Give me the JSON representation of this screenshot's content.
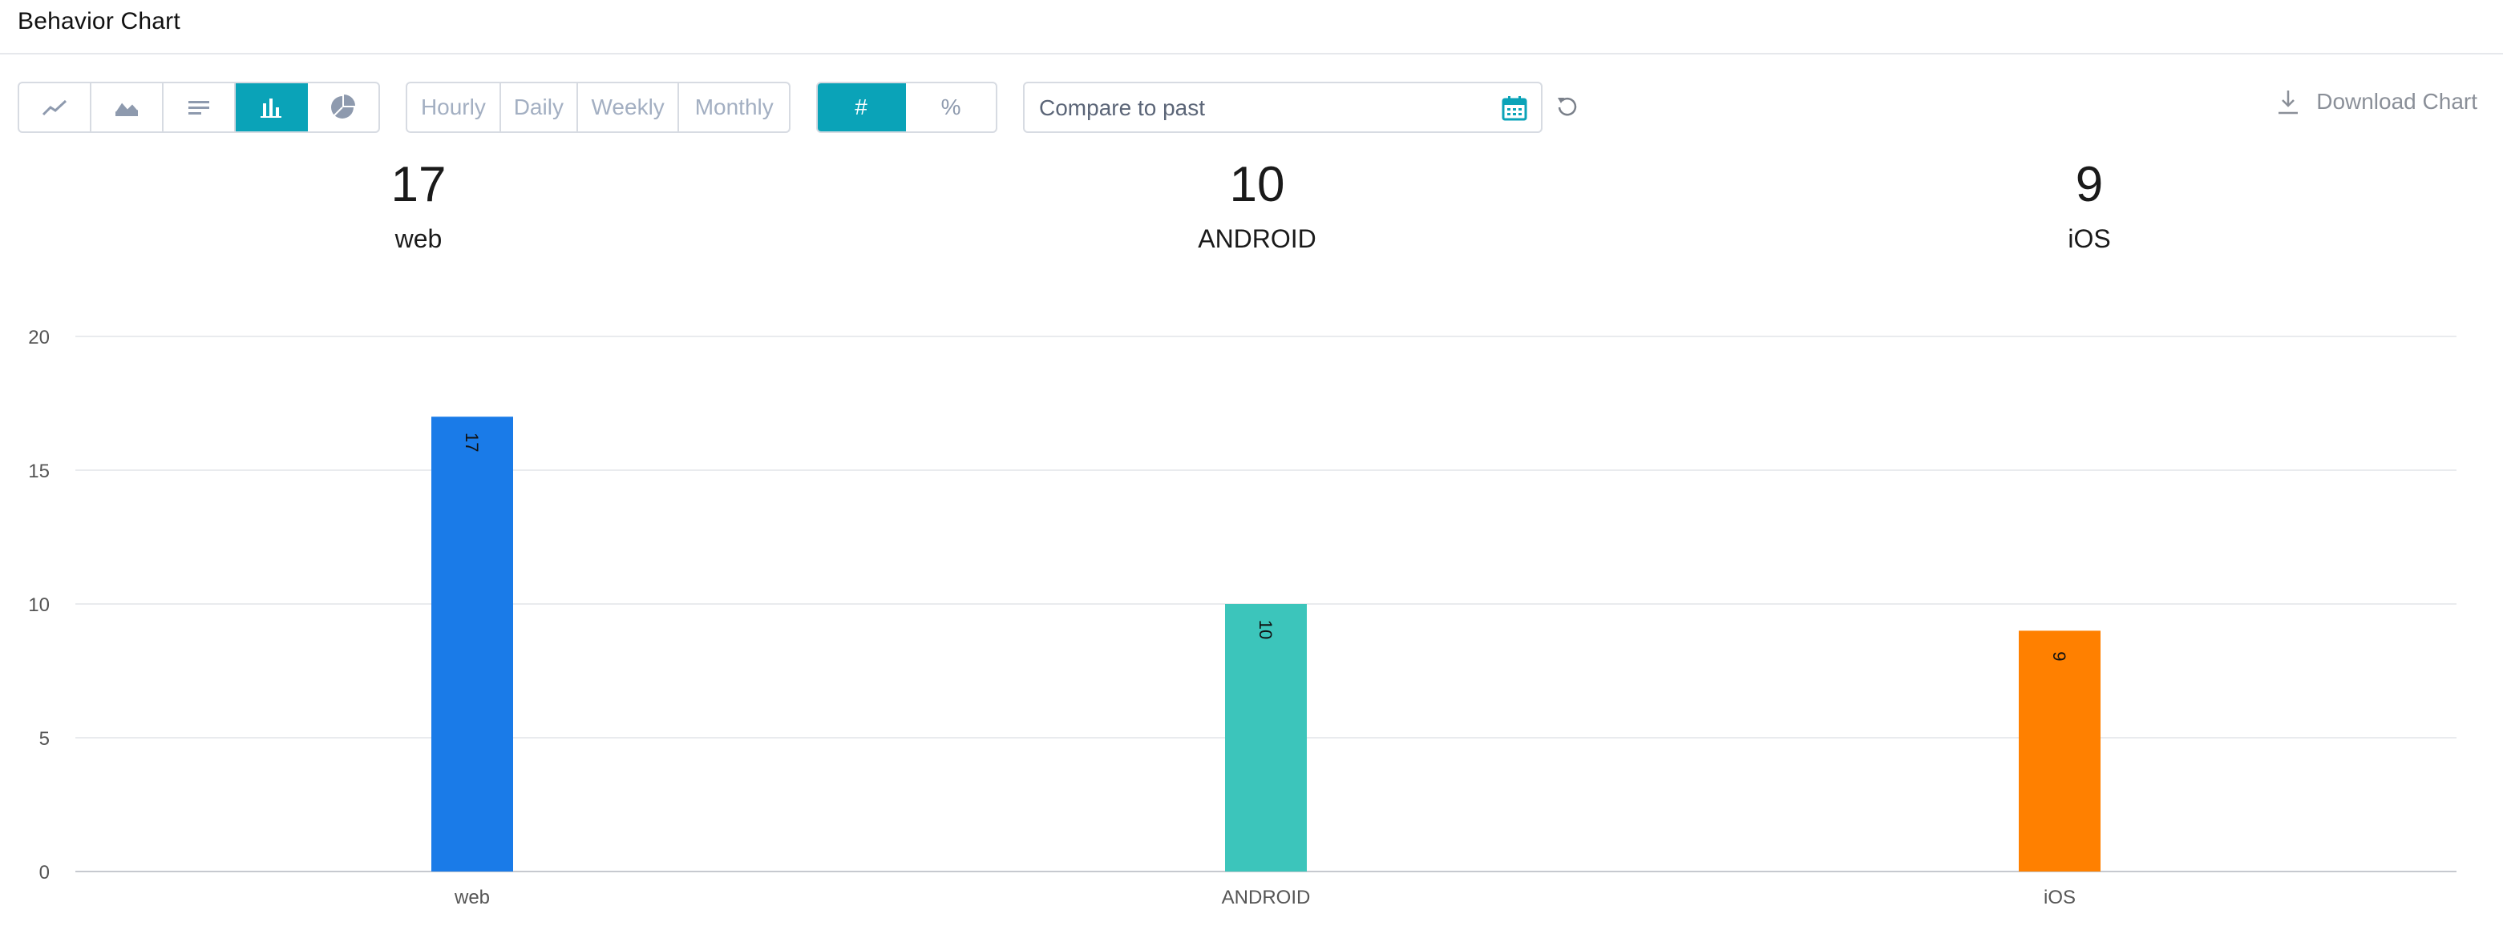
{
  "page": {
    "title": "Behavior Chart"
  },
  "toolbar": {
    "chart_types": [
      "line-chart-icon",
      "area-chart-icon",
      "horizontal-bar-icon",
      "bar-chart-icon",
      "pie-chart-icon"
    ],
    "active_chart_type": "bar-chart-icon",
    "granularity": [
      "Hourly",
      "Daily",
      "Weekly",
      "Monthly"
    ],
    "units": {
      "count": "#",
      "percent": "%",
      "active": "#"
    },
    "compare_placeholder": "Compare to past",
    "download_label": "Download Chart",
    "accent": "#0aa3b8"
  },
  "kpis": [
    {
      "value": "17",
      "label": "web"
    },
    {
      "value": "10",
      "label": "ANDROID"
    },
    {
      "value": "9",
      "label": "iOS"
    }
  ],
  "chart_data": {
    "type": "bar",
    "categories": [
      "web",
      "ANDROID",
      "iOS"
    ],
    "values": [
      17,
      10,
      9
    ],
    "colors": [
      "#1a7be8",
      "#3cc5bb",
      "#ff8000"
    ],
    "ylim": [
      0,
      20
    ],
    "yticks": [
      0,
      5,
      10,
      15,
      20
    ],
    "grid": true,
    "data_labels": true,
    "data_label_rotation": 90,
    "title": "",
    "xlabel": "",
    "ylabel": ""
  }
}
